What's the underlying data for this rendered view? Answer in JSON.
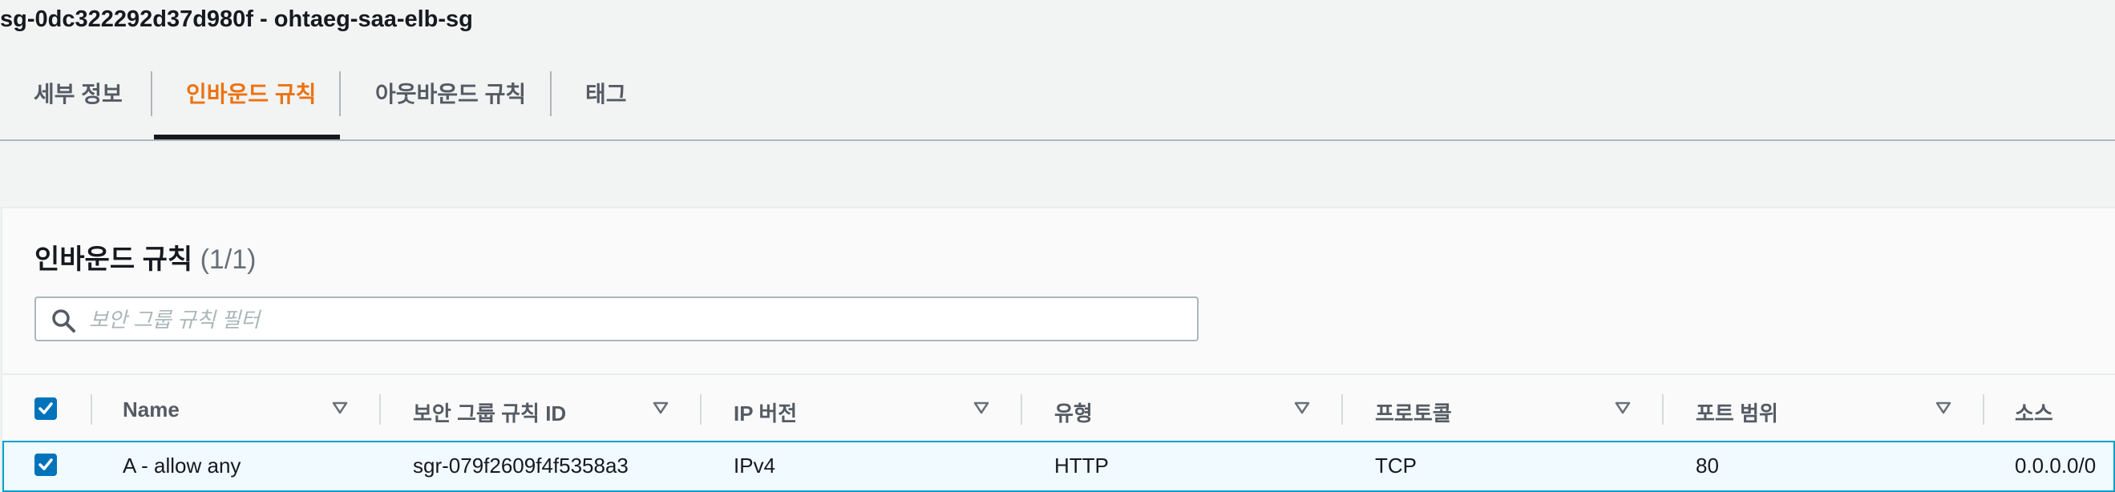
{
  "header": {
    "title": "sg-0dc322292d37d980f - ohtaeg-saa-elb-sg"
  },
  "tabs": [
    {
      "label": "세부 정보"
    },
    {
      "label": "인바운드 규칙",
      "active": true
    },
    {
      "label": "아웃바운드 규칙"
    },
    {
      "label": "태그"
    }
  ],
  "panel": {
    "title": "인바운드 규칙",
    "count": "(1/1)",
    "filter_placeholder": "보안 그룹 규칙 필터"
  },
  "table": {
    "all_selected": true,
    "columns": [
      "Name",
      "보안 그룹 규칙 ID",
      "IP 버전",
      "유형",
      "프로토콜",
      "포트 범위",
      "소스"
    ],
    "rows": [
      {
        "selected": true,
        "cells": [
          "A - allow any",
          "sgr-079f2609f4f5358a3",
          "IPv4",
          "HTTP",
          "TCP",
          "80",
          "0.0.0.0/0"
        ]
      }
    ]
  },
  "colors": {
    "accent": "#ec7211",
    "selection": "#0073bb",
    "row_highlight": "#f1faff"
  }
}
